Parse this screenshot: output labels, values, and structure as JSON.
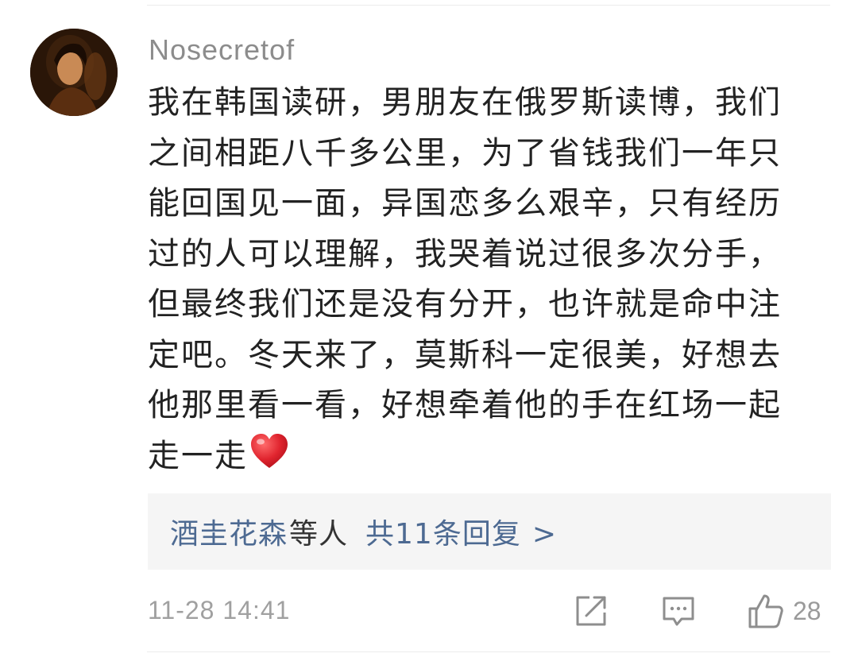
{
  "comment": {
    "username": "Nosecretof",
    "lines": [
      "我在韩国读研，男朋友在俄罗斯读博，我们",
      "之间相距八千多公里，为了省钱我们一年只",
      "能回国见一面，异国恋多么艰辛，只有经历",
      "过的人可以理解，我哭着说过很多次分手，",
      "但最终我们还是没有分开，也许就是命中注",
      "定吧。冬天来了，莫斯科一定很美，好想去",
      "他那里看一看，好想牵着他的手在红场一起",
      "走一走"
    ],
    "emoji": "heart-icon",
    "timestamp": "11-28 14:41",
    "like_count": "28"
  },
  "replies": {
    "user": "酒圭花森",
    "others_suffix": "等人",
    "count_label": "共11条回复",
    "arrow": ">"
  },
  "icons": {
    "share": "share-icon",
    "comment": "comment-icon",
    "like": "thumbs-up-icon"
  },
  "colors": {
    "link": "#4d6a92",
    "text": "#222222",
    "meta": "#a0a0a0",
    "reply_bg": "#f5f5f5",
    "heart": "#e0242e"
  }
}
